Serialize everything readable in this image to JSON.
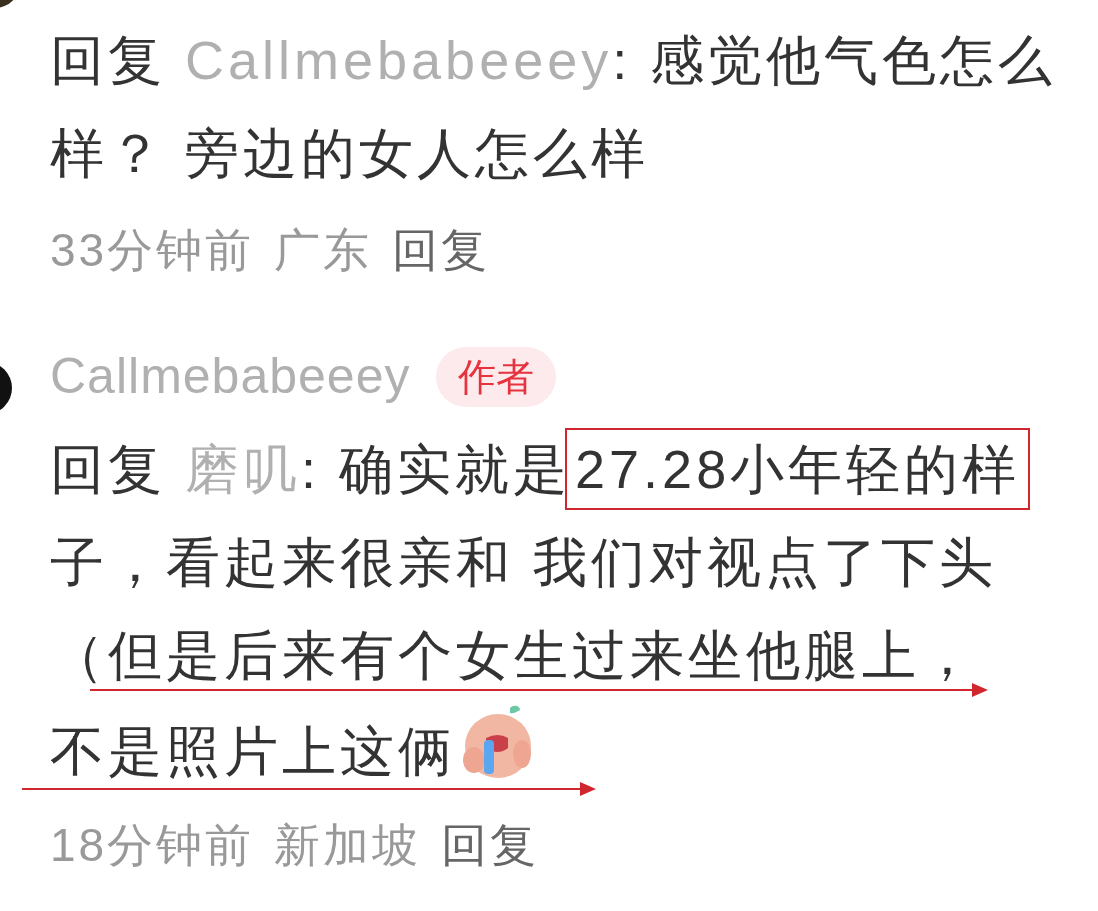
{
  "comments": [
    {
      "body_lines": [
        [
          {
            "kind": "plain",
            "text": "回复 "
          },
          {
            "kind": "mention",
            "text": "Callmebabeeey"
          },
          {
            "kind": "plain",
            "text": ": 感觉他气色怎么"
          }
        ],
        [
          {
            "kind": "plain",
            "text": "样？ 旁边的女人怎么样"
          }
        ]
      ],
      "meta": {
        "time": "33分钟前",
        "location": "广东",
        "reply": "回复"
      }
    },
    {
      "author": {
        "name": "Callmebabeeey",
        "badge": "作者"
      },
      "body_lines": [
        [
          {
            "kind": "plain",
            "text": "回复 "
          },
          {
            "kind": "mention",
            "text": "磨叽"
          },
          {
            "kind": "plain",
            "text": ": 确实就是"
          },
          {
            "kind": "boxed",
            "text": "27.28小年轻的样"
          }
        ],
        [
          {
            "kind": "plain",
            "text": "子，看起来很亲和 我们对视点了下头"
          }
        ],
        [
          {
            "kind": "plain",
            "text": "（但是后来有个女生过来坐他腿上，",
            "underline_arrow": true
          }
        ],
        [
          {
            "kind": "plain",
            "text": "不是照片上这俩",
            "underline_arrow": true
          },
          {
            "kind": "emoji"
          }
        ]
      ],
      "meta": {
        "time": "18分钟前",
        "location": "新加坡",
        "reply": "回复"
      }
    }
  ]
}
